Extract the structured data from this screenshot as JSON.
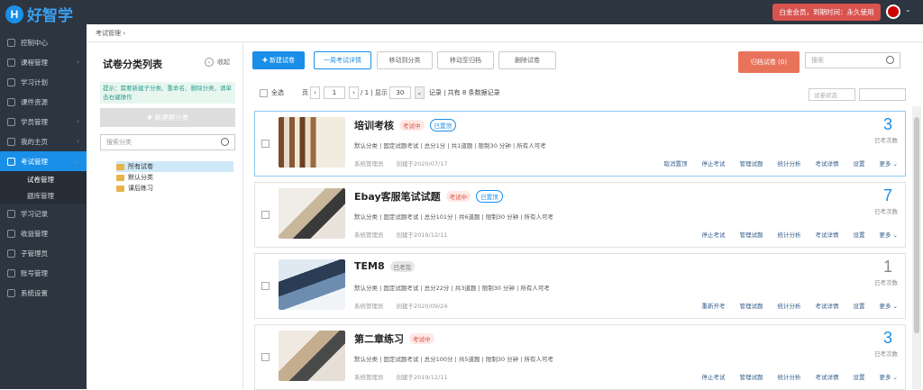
{
  "app": {
    "logo_letter": "H",
    "logo_text": "好智学",
    "vip": "白金会员，到期时间：永久使用",
    "user_arrow": "⌄"
  },
  "sidebar": {
    "items": [
      {
        "label": "控制中心",
        "arrow": ""
      },
      {
        "label": "课程管理",
        "arrow": "‹"
      },
      {
        "label": "学习计划",
        "arrow": ""
      },
      {
        "label": "课件资源",
        "arrow": ""
      },
      {
        "label": "学员管理",
        "arrow": "‹"
      },
      {
        "label": "我的主页",
        "arrow": "‹"
      },
      {
        "label": "考试管理",
        "arrow": "⌄"
      }
    ],
    "subitems": [
      "试卷管理",
      "题库管理"
    ],
    "items2": [
      {
        "label": "学习记录"
      },
      {
        "label": "收益管理"
      },
      {
        "label": "子管理员"
      },
      {
        "label": "账号管理"
      },
      {
        "label": "系统设置"
      }
    ]
  },
  "breadcrumb": "考试管理 ›",
  "left": {
    "title": "试卷分类列表",
    "collapse": "收起",
    "tip": "提示：需要新建子分类、重命名、删除分类，请单击右键操作",
    "new_category": "✚ 新建根分类",
    "search_placeholder": "搜索分类",
    "tree": [
      "所有试卷",
      "默认分类",
      "课后练习"
    ]
  },
  "toolbar": {
    "new": "✚ 新建试卷",
    "one_week": "一周考试详情",
    "move": "移动到分类",
    "archive_move": "移动至归档",
    "delete": "删除试卷",
    "archived": "归档试卷 (0)",
    "search_placeholder": "搜索"
  },
  "pager": {
    "select_all": "全选",
    "page_label": "页",
    "page": "1",
    "total_pages": "/ 1 | 显示",
    "per_page": "30",
    "summary": "记录 | 共有 8 条数据记录",
    "status_placeholder": "试卷状态"
  },
  "exams": [
    {
      "title": "培训考核",
      "badges": [
        {
          "t": "考试中",
          "c": "b-red"
        },
        {
          "t": "已置顶",
          "c": "b-blue"
        }
      ],
      "meta": "默认分类 | 固定试题考试 | 总分1分 | 共1道题 | 限制30 分钟 | 所有人可考",
      "author": "系统管理员",
      "created": "创建于2020/07/17",
      "actions": [
        "取消置顶",
        "停止考试",
        "管理试题",
        "统计分析",
        "考试详情",
        "设置",
        "更多 ⌄"
      ],
      "count": "3",
      "count_label": "已考次数"
    },
    {
      "title": "Ebay客服笔试试题",
      "badges": [
        {
          "t": "考试中",
          "c": "b-red"
        },
        {
          "t": "已置顶",
          "c": "b-blue"
        }
      ],
      "meta": "默认分类 | 固定试题考试 | 总分101分 | 共6道题 | 限制30 分钟 | 所有人可考",
      "author": "系统管理员",
      "created": "创建于2019/12/11",
      "actions": [
        "停止考试",
        "管理试题",
        "统计分析",
        "考试详情",
        "设置",
        "更多 ⌄"
      ],
      "count": "7",
      "count_label": "已考次数"
    },
    {
      "title": "TEM8",
      "badges": [
        {
          "t": "已考完",
          "c": "b-gray"
        }
      ],
      "meta": "默认分类 | 固定试题考试 | 总分22分 | 共3道题 | 限制30 分钟 | 所有人可考",
      "author": "系统管理员",
      "created": "创建于2020/09/24",
      "actions": [
        "重新开考",
        "管理试题",
        "统计分析",
        "考试详情",
        "设置",
        "更多 ⌄"
      ],
      "count": "1",
      "count_label": "已考次数"
    },
    {
      "title": "第二章练习",
      "badges": [
        {
          "t": "考试中",
          "c": "b-red"
        }
      ],
      "meta": "默认分类 | 固定试题考试 | 总分100分 | 共5道题 | 限制30 分钟 | 所有人可考",
      "author": "系统管理员",
      "created": "创建于2019/12/11",
      "actions": [
        "停止考试",
        "管理试题",
        "统计分析",
        "考试详情",
        "设置",
        "更多 ⌄"
      ],
      "count": "3",
      "count_label": "已考次数"
    }
  ]
}
